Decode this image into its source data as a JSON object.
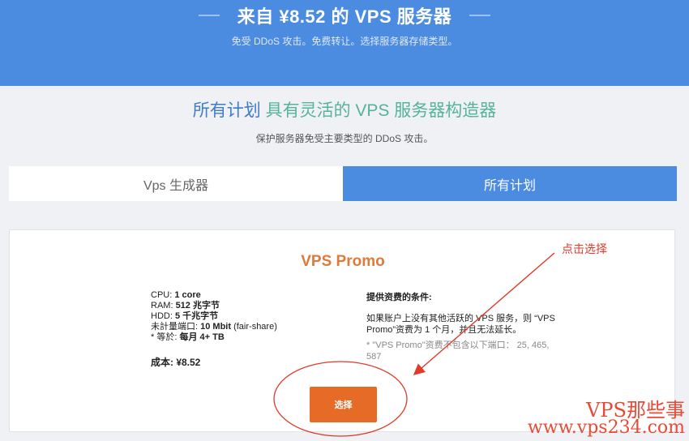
{
  "hero": {
    "title": "来自 ¥8.52 的 VPS 服务器",
    "subtitle": "免受 DDoS 攻击。免费转让。选择服务器存储类型。"
  },
  "section": {
    "title_highlight": "所有计划",
    "title_rest": " 具有灵活的 VPS 服务器构造器",
    "subtitle": "保护服务器免受主要类型的 DDoS 攻击。"
  },
  "tabs": [
    {
      "label": "Vps 生成器",
      "active": false
    },
    {
      "label": "所有计划",
      "active": true
    }
  ],
  "plan": {
    "name": "VPS Promo",
    "specs": [
      {
        "label": "CPU: ",
        "value": "1 core"
      },
      {
        "label": "RAM: ",
        "value": "512 兆字节"
      },
      {
        "label": "HDD: ",
        "value": "5 千兆字节"
      },
      {
        "label": "未計量端口: ",
        "value": "10 Mbit",
        "suffix": " (fair-share)"
      },
      {
        "label": "* 等於: ",
        "value": "每月 4+ TB"
      }
    ],
    "cost": "成本: ¥8.52",
    "conditions_title": "提供资费的条件:",
    "conditions_text": "如果账户上没有其他活跃的 VPS 服务，则 “VPS Promo”资费为 1 个月，并且无法延长。",
    "conditions_note": "* \"VPS Promo\"资费不包含以下端口： 25, 465, 587",
    "select_label": "选择"
  },
  "annotation": {
    "label": "点击选择",
    "color": "#e03a2a"
  },
  "watermark": {
    "line1": "VPS那些事",
    "line2": "www.vps234.com"
  }
}
